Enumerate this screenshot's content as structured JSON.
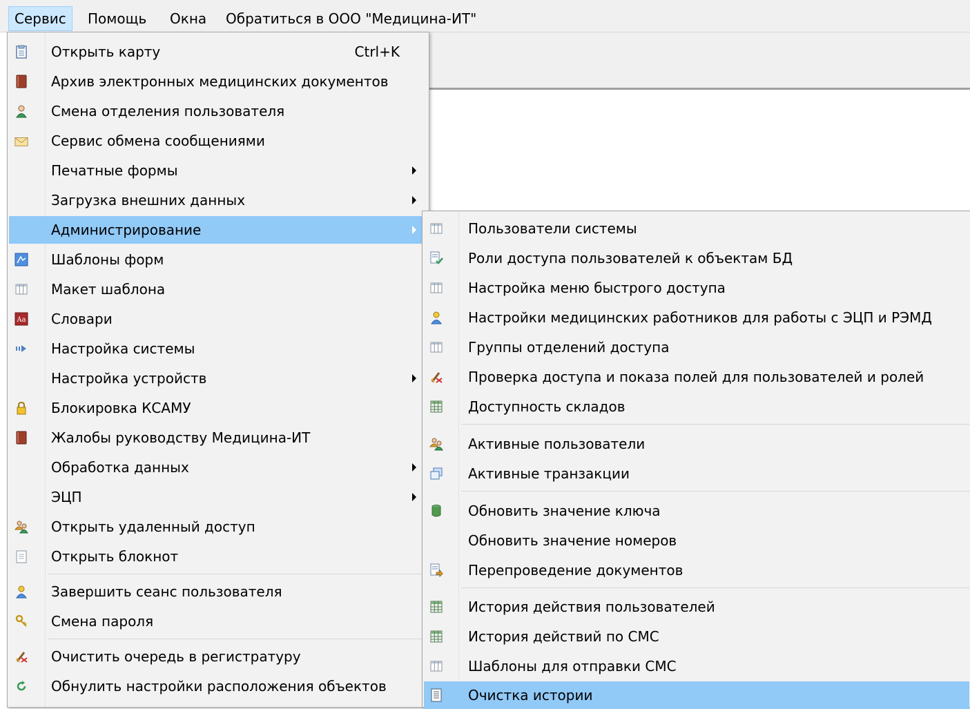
{
  "menubar": {
    "items": [
      {
        "label": "Сервис",
        "active": true
      },
      {
        "label": "Помощь",
        "active": false
      },
      {
        "label": "Окна",
        "active": false
      },
      {
        "label": "Обратиться в ООО \"Медицина-ИТ\"",
        "active": false
      }
    ]
  },
  "service_menu": {
    "items": [
      {
        "label": "Открыть карту",
        "shortcut": "Ctrl+K",
        "icon": "card-file-icon"
      },
      {
        "label": "Архив электронных медицинских документов",
        "icon": "book-icon"
      },
      {
        "label": "Смена отделения пользователя",
        "icon": "user-green-icon"
      },
      {
        "label": "Сервис обмена сообщениями",
        "icon": "envelope-icon"
      },
      {
        "label": "Печатные формы",
        "submenu": true
      },
      {
        "label": "Загрузка внешних данных",
        "submenu": true
      },
      {
        "label": "Администрирование",
        "submenu": true,
        "highlighted": true
      },
      {
        "label": "Шаблоны форм",
        "icon": "form-template-icon"
      },
      {
        "label": "Макет шаблона",
        "icon": "grid-icon"
      },
      {
        "label": "Словари",
        "icon": "dictionary-icon",
        "icon_text": "Aa"
      },
      {
        "label": "Настройка системы",
        "icon": "arrow-right-icon"
      },
      {
        "label": "Настройка устройств",
        "submenu": true
      },
      {
        "label": "Блокировка КСАМУ",
        "icon": "lock-icon"
      },
      {
        "label": "Жалобы руководству Медицина-ИТ",
        "icon": "book-icon"
      },
      {
        "label": "Обработка данных",
        "submenu": true
      },
      {
        "label": "ЭЦП",
        "submenu": true
      },
      {
        "label": "Открыть удаленный доступ",
        "icon": "users-icon"
      },
      {
        "label": "Открыть блокнот",
        "icon": "notepad-icon"
      },
      {
        "label": "Завершить сеанс пользователя",
        "icon": "user-blue-icon"
      },
      {
        "label": "Смена пароля",
        "icon": "key-icon"
      },
      {
        "label": "Очистить очередь в регистратуру",
        "icon": "clear-icon"
      },
      {
        "label": "Обнулить настройки расположения объектов",
        "icon": "refresh-icon"
      }
    ]
  },
  "admin_submenu": {
    "items": [
      {
        "label": "Пользователи системы",
        "icon": "grid-icon"
      },
      {
        "label": "Роли доступа пользователей к объектам БД",
        "icon": "doc-check-icon"
      },
      {
        "label": "Настройка меню быстрого доступа",
        "icon": "grid-icon"
      },
      {
        "label": "Настройки медицинских работников для работы с ЭЦП и РЭМД",
        "icon": "user-blue-icon"
      },
      {
        "label": "Группы отделений доступа",
        "icon": "grid-icon"
      },
      {
        "label": "Проверка доступа и показа полей для пользователей и ролей",
        "icon": "clear-icon"
      },
      {
        "label": "Доступность складов",
        "icon": "table-green-icon"
      },
      {
        "label": "Активные пользователи",
        "icon": "users-icon"
      },
      {
        "label": "Активные транзакции",
        "icon": "windows-icon"
      },
      {
        "label": "Обновить значение ключа",
        "icon": "database-icon"
      },
      {
        "label": "Обновить значение номеров"
      },
      {
        "label": "Перепроведение документов",
        "icon": "doc-arrow-icon"
      },
      {
        "label": "История действия пользователей",
        "icon": "table-green-icon"
      },
      {
        "label": "История действий по СМС",
        "icon": "table-green-icon"
      },
      {
        "label": "Шаблоны для отправки СМС",
        "icon": "grid-icon"
      },
      {
        "label": "Очистка истории",
        "icon": "doc-list-icon",
        "highlighted": true
      }
    ]
  }
}
